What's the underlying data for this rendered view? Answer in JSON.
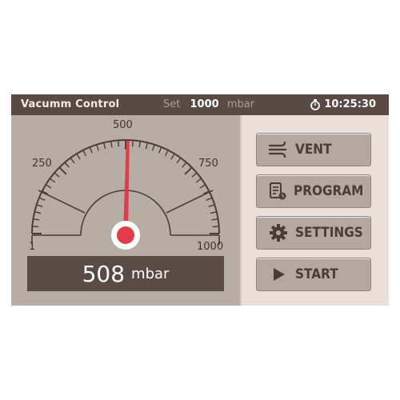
{
  "header": {
    "title": "Vacumm Control",
    "set_label": "Set",
    "set_value": "1000",
    "set_unit": "mbar",
    "time": "10:25:30",
    "timer_icon": "stopwatch-icon"
  },
  "gauge": {
    "min_label": "1",
    "low_label": "250",
    "mid_label": "500",
    "high_label": "750",
    "max_label": "1000",
    "reading_value": "508",
    "reading_unit": "mbar",
    "needle_value": 508,
    "needle_color": "#e23c48"
  },
  "buttons": {
    "vent": {
      "label": "VENT",
      "icon": "vent-fan-icon"
    },
    "program": {
      "label": "PROGRAM",
      "icon": "program-document-icon"
    },
    "settings": {
      "label": "SETTINGS",
      "icon": "gear-icon"
    },
    "start": {
      "label": "START",
      "icon": "play-icon"
    }
  },
  "colors": {
    "header_bg": "#5a4a44",
    "gauge_bg": "#b6ada5",
    "panel_bg": "#e9e0d9",
    "button_bg": "#b3a9a1",
    "accent": "#e23c48"
  }
}
